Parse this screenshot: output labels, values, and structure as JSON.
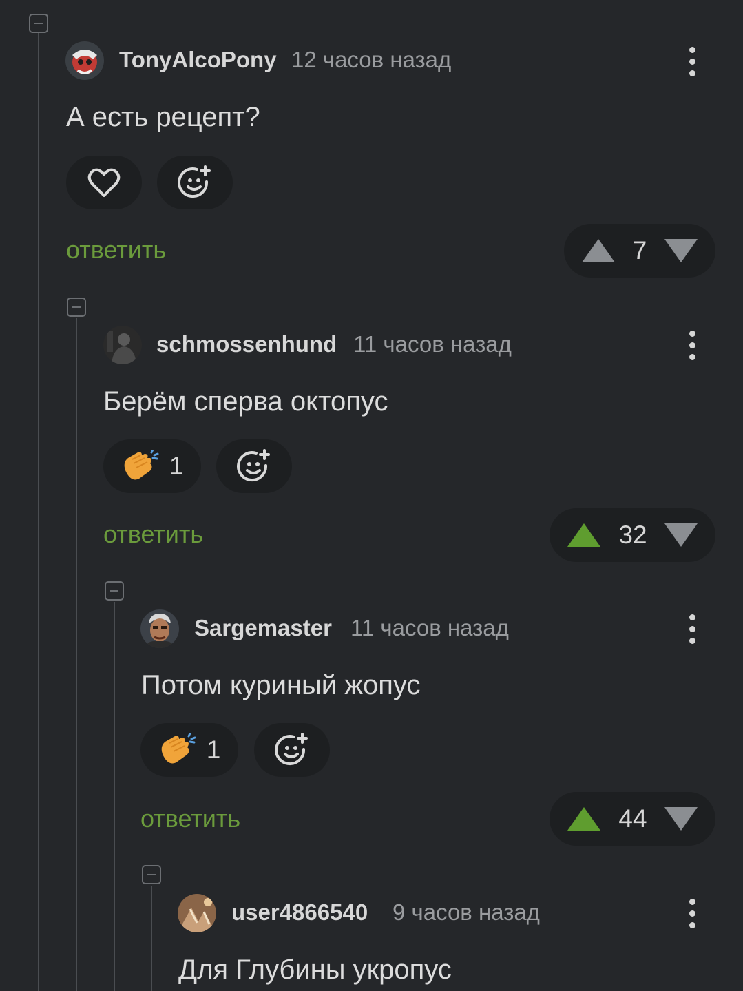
{
  "colors": {
    "background": "#25272a",
    "accent_green": "#6b9b3c",
    "upvote_active": "#5f9d2f",
    "vote_neutral": "#8b8e92"
  },
  "comments": [
    {
      "username": "TonyAlcoPony",
      "time": "12 часов назад",
      "text": "А есть рецепт?",
      "reaction_icon": "heart-icon",
      "reaction_count": "",
      "reply_label": "ответить",
      "score": "7",
      "upvoted": false
    },
    {
      "username": "schmossenhund",
      "time": "11 часов назад",
      "text": "Берём сперва октопус",
      "reaction_icon": "clapping-hands-icon",
      "reaction_count": "1",
      "reply_label": "ответить",
      "score": "32",
      "upvoted": true
    },
    {
      "username": "Sargemaster",
      "time": "11 часов назад",
      "text": "Потом куриный жопус",
      "reaction_icon": "clapping-hands-icon",
      "reaction_count": "1",
      "reply_label": "ответить",
      "score": "44",
      "upvoted": true
    },
    {
      "username": "user4866540",
      "time": "9 часов назад",
      "text": "Для Глубины укропус"
    }
  ]
}
